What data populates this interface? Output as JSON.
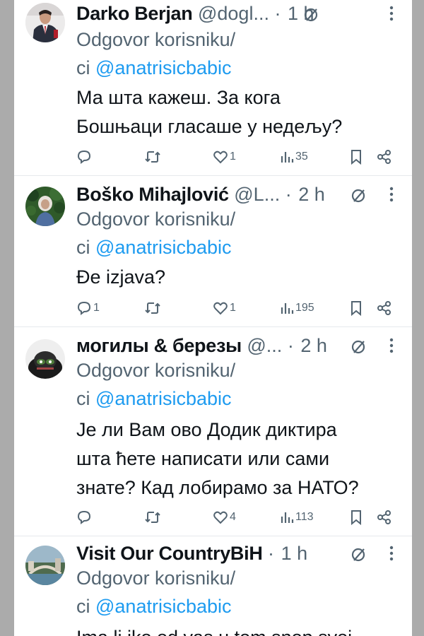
{
  "reply_prefix": "Odgovor korisniku/",
  "reply_mention_prefix": "ci ",
  "tweets": [
    {
      "name": "Darko Berjan",
      "handle": "@dogl...",
      "dot": "·",
      "time": "1 h",
      "mention": "@anatrisicbabic",
      "text_lines": [
        "Ма шта кажеш. За кога",
        "Бошњаци гласаше у недељу?"
      ],
      "replies": "",
      "likes": "1",
      "views": "35"
    },
    {
      "name": "Boško Mihajlović",
      "handle": "@L...",
      "dot": "·",
      "time": "2 h",
      "mention": "@anatrisicbabic",
      "text_lines": [
        "Đe izjava?"
      ],
      "replies": "1",
      "likes": "1",
      "views": "195"
    },
    {
      "name": "могилы & березы",
      "handle": "@...",
      "dot": "·",
      "time": "2 h",
      "mention": "@anatrisicbabic",
      "text_lines": [
        "Је ли Вам ово Додик диктира",
        "шта ћете написати или сами",
        "знате? Кад лобирамо за НАТО?"
      ],
      "replies": "",
      "likes": "4",
      "views": "113"
    },
    {
      "name": "Visit Our CountryBiH",
      "handle": "",
      "dot": "·",
      "time": "1 h",
      "mention": "@anatrisicbabic",
      "text_lines": [
        "Ima li iko od vas u tom snop svoj"
      ],
      "replies": "",
      "likes": "",
      "views": ""
    }
  ],
  "icons": {
    "reply": "reply-bubble-icon",
    "retweet": "retweet-icon",
    "like": "heart-icon",
    "views": "views-chart-icon",
    "bookmark": "bookmark-icon",
    "share": "share-icon",
    "grok": "grok-slash-circle-icon",
    "more": "more-vertical-icon"
  },
  "colors": {
    "text": "#0f1419",
    "secondary": "#536471",
    "mention": "#1d9bf0",
    "divider": "#e6e9ec"
  }
}
